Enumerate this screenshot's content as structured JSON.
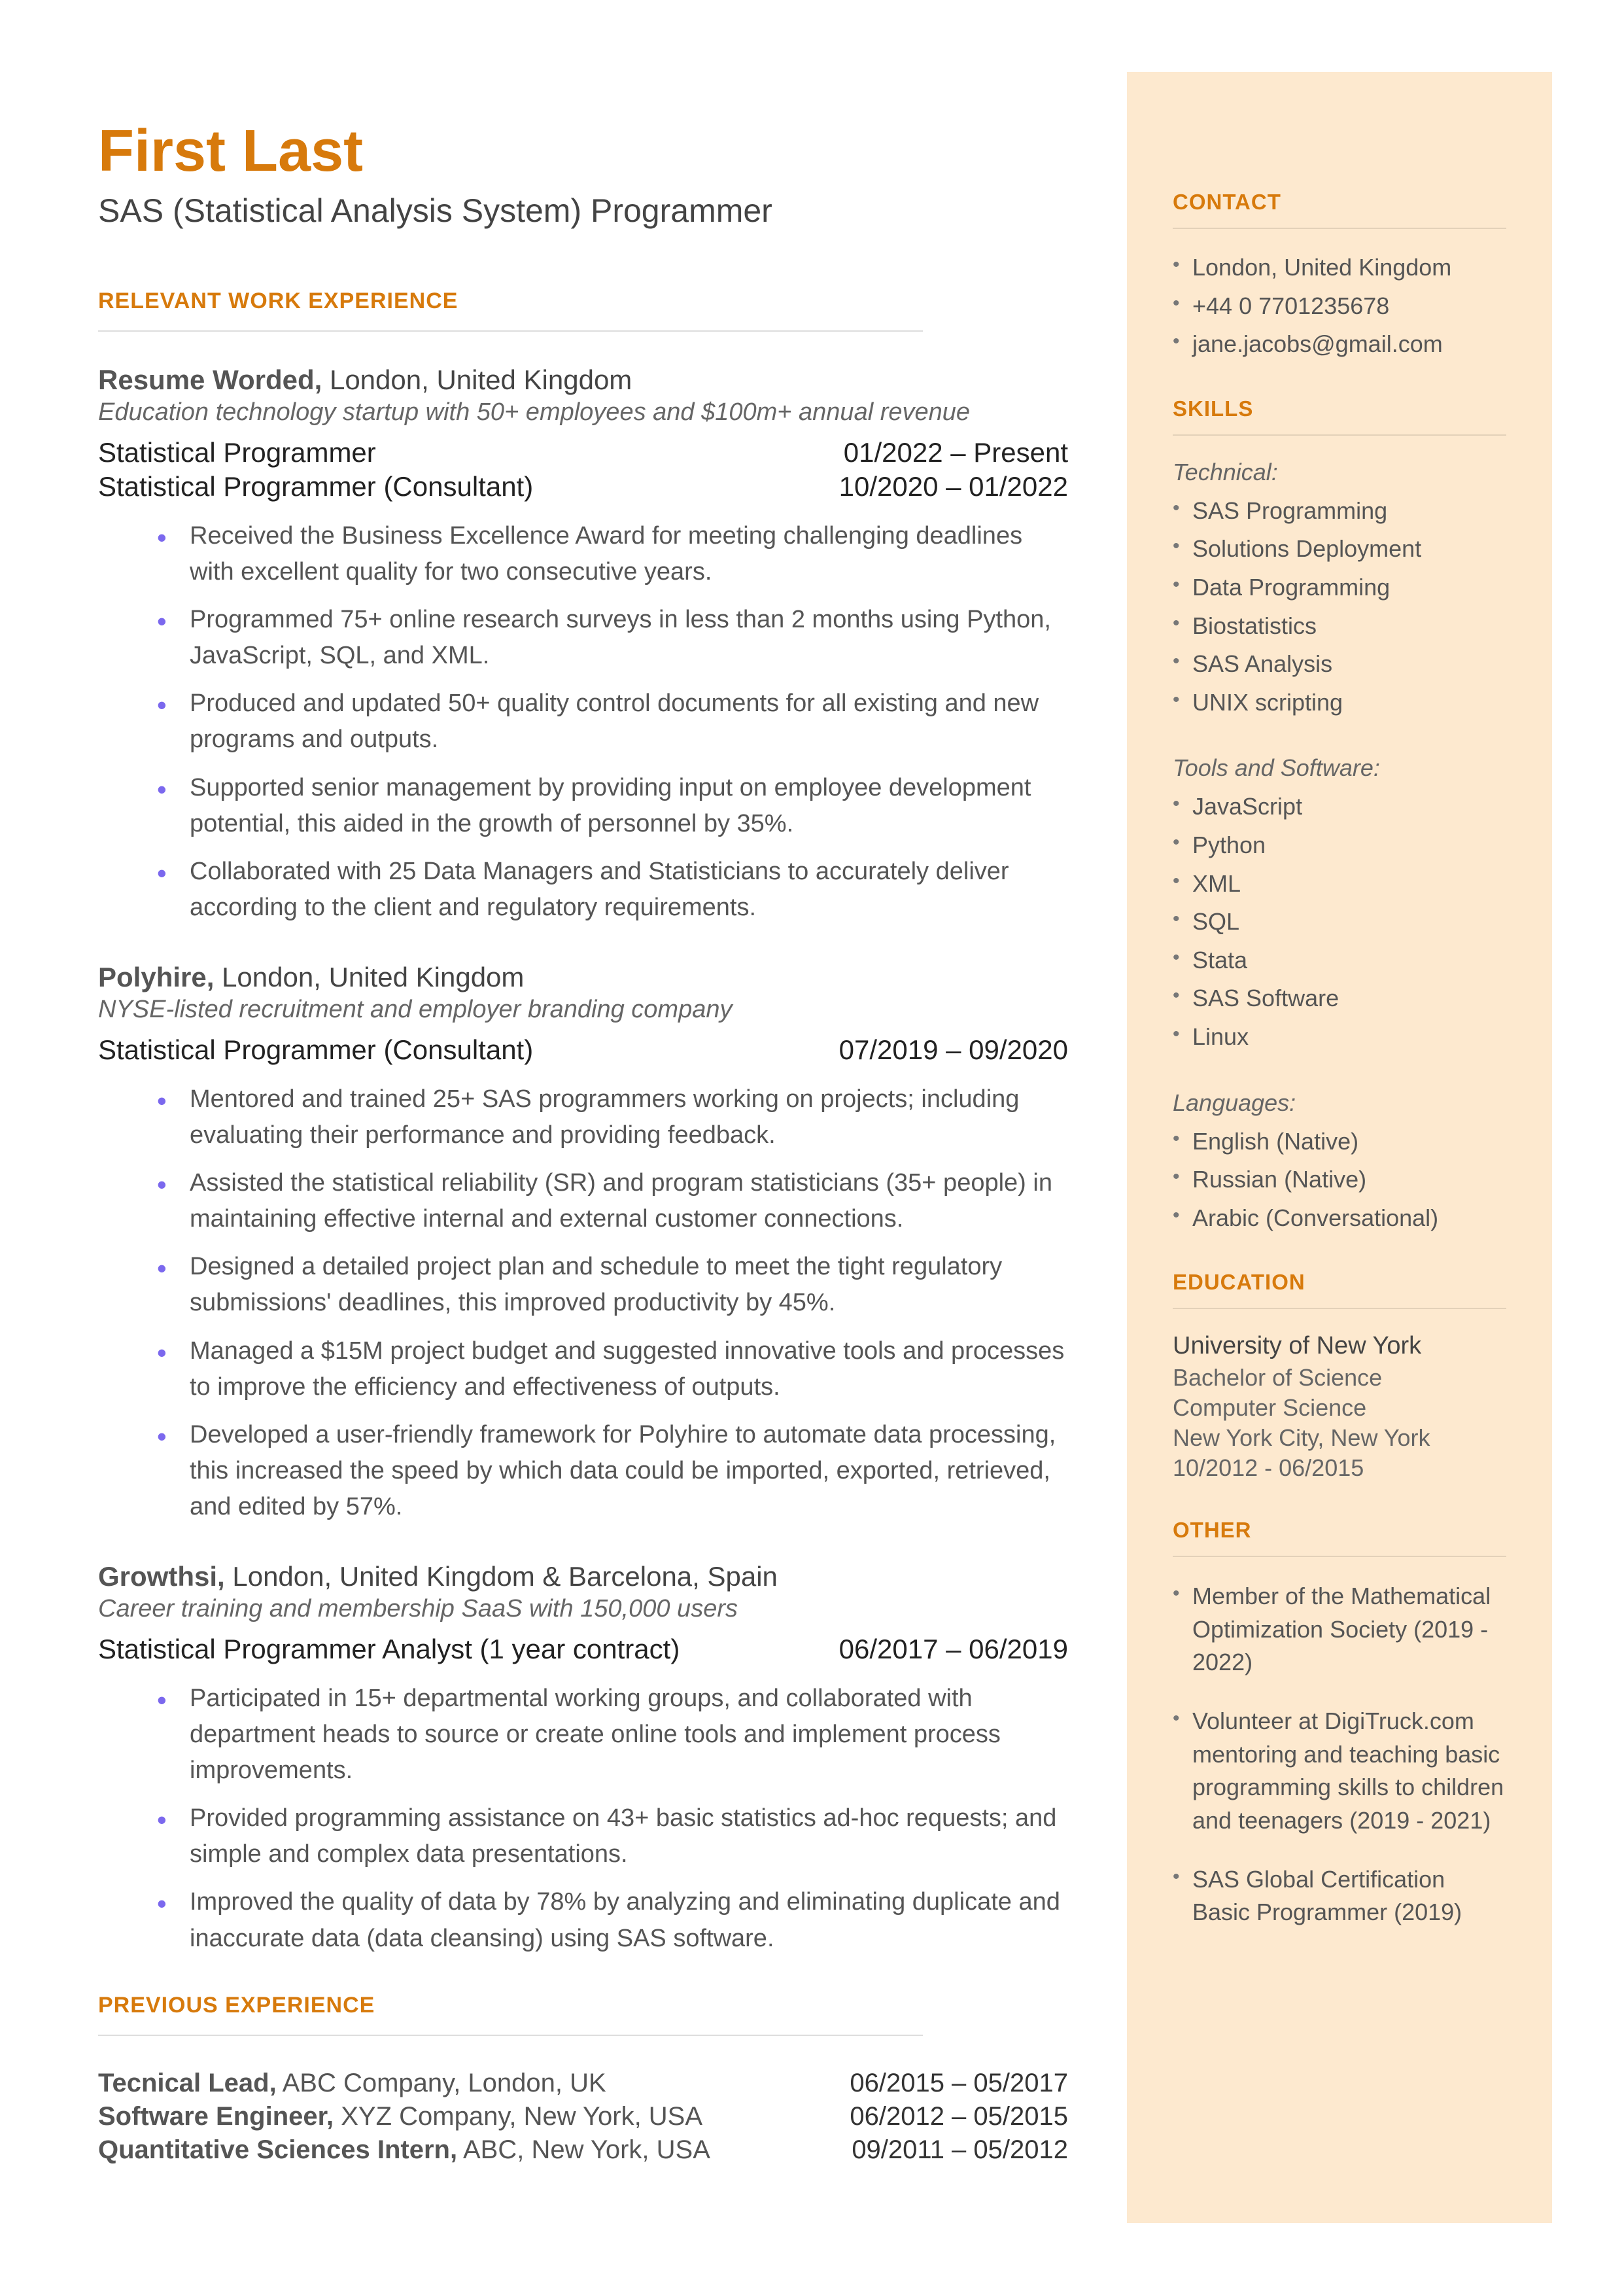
{
  "header": {
    "name": "First Last",
    "subtitle": "SAS (Statistical Analysis System) Programmer"
  },
  "sections": {
    "work_heading": "RELEVANT WORK EXPERIENCE",
    "previous_heading": "PREVIOUS EXPERIENCE"
  },
  "jobs": [
    {
      "company": "Resume Worded,",
      "location": "London, United Kingdom",
      "desc": "Education technology startup with 50+ employees and $100m+ annual revenue",
      "roles": [
        {
          "title": "Statistical Programmer",
          "dates": "01/2022 – Present"
        },
        {
          "title": "Statistical Programmer (Consultant)",
          "dates": "10/2020 – 01/2022"
        }
      ],
      "bullets": [
        "Received the Business Excellence Award for meeting challenging deadlines with excellent quality for two consecutive years.",
        "Programmed 75+ online research surveys in less than 2 months using Python, JavaScript, SQL, and XML.",
        "Produced and updated 50+ quality control documents for all existing and new programs and outputs.",
        "Supported senior management by providing input on employee development potential, this aided in the growth of personnel by 35%.",
        "Collaborated with 25 Data Managers and Statisticians to accurately deliver according to the client and regulatory requirements."
      ]
    },
    {
      "company": "Polyhire,",
      "location": "London, United Kingdom",
      "desc": "NYSE-listed recruitment and employer branding company",
      "roles": [
        {
          "title": "Statistical Programmer (Consultant)",
          "dates": "07/2019 – 09/2020"
        }
      ],
      "bullets": [
        "Mentored and trained 25+ SAS programmers working on projects; including evaluating their performance and providing feedback.",
        "Assisted the statistical reliability (SR) and program statisticians (35+ people) in maintaining effective internal and external customer connections.",
        "Designed a detailed project plan and schedule to meet the tight regulatory submissions' deadlines, this improved productivity by 45%.",
        "Managed a $15M project budget and suggested innovative tools and processes to improve the efficiency and effectiveness of outputs.",
        "Developed a user-friendly framework for Polyhire to automate data processing, this increased the speed by which data could be imported, exported, retrieved, and edited by 57%."
      ]
    },
    {
      "company": "Growthsi,",
      "location": "London, United Kingdom & Barcelona, Spain",
      "desc": "Career training and membership SaaS with 150,000 users",
      "roles": [
        {
          "title": "Statistical Programmer Analyst (1 year contract)",
          "dates": "06/2017 – 06/2019"
        }
      ],
      "bullets": [
        "Participated in 15+ departmental working groups, and collaborated with department heads to source or create online tools and implement process improvements.",
        "Provided programming assistance on 43+ basic statistics ad-hoc requests; and simple and complex data presentations.",
        "Improved the quality of data by 78% by analyzing and eliminating duplicate and inaccurate data (data cleansing) using SAS software."
      ]
    }
  ],
  "previous": [
    {
      "title": "Tecnical Lead,",
      "rest": " ABC Company, London, UK",
      "dates": "06/2015 – 05/2017"
    },
    {
      "title": "Software Engineer,",
      "rest": " XYZ Company, New York, USA",
      "dates": "06/2012 – 05/2015"
    },
    {
      "title": "Quantitative Sciences Intern,",
      "rest": " ABC, New York, USA",
      "dates": "09/2011 – 05/2012"
    }
  ],
  "sidebar": {
    "contact_heading": "CONTACT",
    "contact": [
      "London, United Kingdom",
      "+44 0 7701235678",
      "jane.jacobs@gmail.com"
    ],
    "skills_heading": "SKILLS",
    "technical_label": "Technical:",
    "technical": [
      "SAS Programming",
      "Solutions Deployment",
      "Data Programming",
      "Biostatistics",
      "SAS Analysis",
      "UNIX scripting"
    ],
    "tools_label": "Tools and Software:",
    "tools": [
      "JavaScript",
      "Python",
      "XML",
      "SQL",
      "Stata",
      "SAS Software",
      "Linux"
    ],
    "languages_label": "Languages:",
    "languages": [
      "English (Native)",
      "Russian (Native)",
      "Arabic (Conversational)"
    ],
    "education_heading": "EDUCATION",
    "education": {
      "school": "University of New York",
      "degree": "Bachelor of Science",
      "major": "Computer Science",
      "location": "New York City, New York",
      "dates": "10/2012 - 06/2015"
    },
    "other_heading": "OTHER",
    "other": [
      "Member of the Mathematical Optimization Society (2019 - 2022)",
      "Volunteer at DigiTruck.com mentoring and teaching basic programming skills to children and teenagers (2019 - 2021)",
      "SAS Global Certification Basic Programmer (2019)"
    ]
  }
}
